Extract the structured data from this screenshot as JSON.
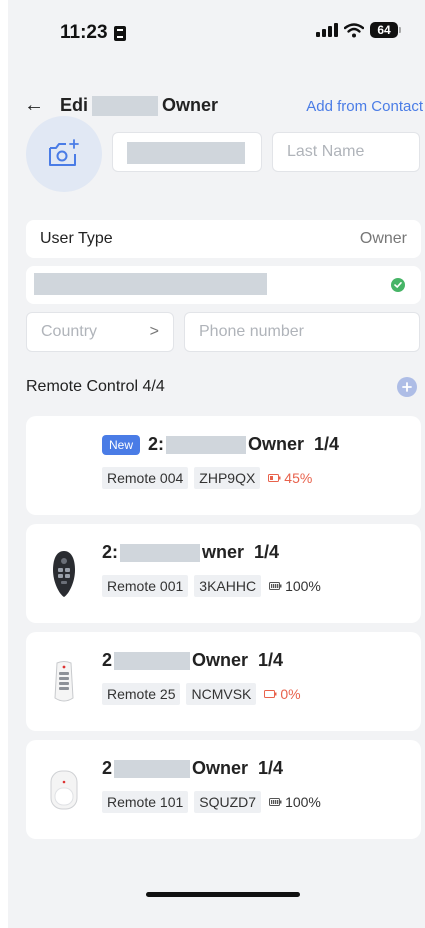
{
  "status_bar": {
    "time": "11:23",
    "battery": "64"
  },
  "header": {
    "title_prefix": "Edi",
    "title_suffix": "Owner",
    "add_from_contact": "Add from Contact"
  },
  "form": {
    "last_name_placeholder": "Last Name",
    "user_type_label": "User Type",
    "user_type_value": "Owner",
    "country_placeholder": "Country",
    "country_chevron": ">",
    "phone_placeholder": "Phone number"
  },
  "remote_section": {
    "title": "Remote Control 4/4"
  },
  "colors": {
    "accent": "#4a7ce6",
    "low_battery": "#e8624c",
    "success": "#46b466"
  },
  "remotes": [
    {
      "badge": "New",
      "prefix": "2:",
      "suffix": "Owner",
      "count": "1/4",
      "name": "Remote 004",
      "code": "ZHP9QX",
      "battery": "45%",
      "battery_state": "low",
      "icon": "none"
    },
    {
      "badge": "",
      "prefix": "2:",
      "suffix": "wner",
      "count": "1/4",
      "name": "Remote 001",
      "code": "3KAHHC",
      "battery": "100%",
      "battery_state": "full",
      "icon": "black-keyfob-remote-icon"
    },
    {
      "badge": "",
      "prefix": "2",
      "suffix": "Owner",
      "count": "1/4",
      "name": "Remote 25",
      "code": "NCMVSK",
      "battery": "0%",
      "battery_state": "low",
      "icon": "white-button-remote-icon"
    },
    {
      "badge": "",
      "prefix": "2",
      "suffix": "Owner",
      "count": "1/4",
      "name": "Remote 101",
      "code": "SQUZD7",
      "battery": "100%",
      "battery_state": "full",
      "icon": "white-pendant-remote-icon"
    }
  ]
}
